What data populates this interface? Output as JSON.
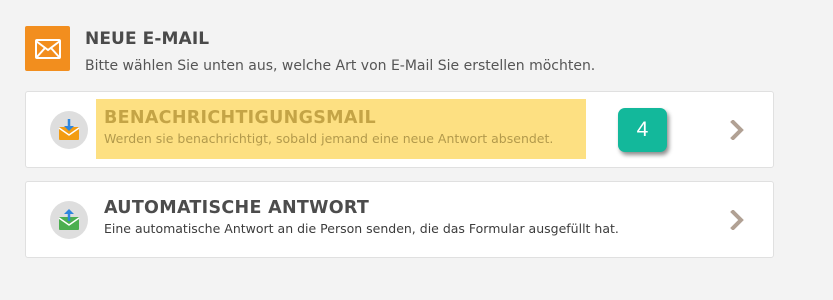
{
  "header": {
    "icon": "envelope-icon",
    "title": "NEUE E-MAIL",
    "subtitle": "Bitte wählen Sie unten aus, welche Art von E-Mail Sie erstellen möchten."
  },
  "options": [
    {
      "icon": "notification-mail-icon",
      "title": "BENACHRICHTIGUNGSMAIL",
      "description": "Werden sie benachrichtigt, sobald jemand eine neue Antwort absendet.",
      "badge": "4",
      "highlighted": true
    },
    {
      "icon": "autoresponder-mail-icon",
      "title": "AUTOMATISCHE ANTWORT",
      "description": "Eine automatische Antwort an die Person senden, die das Formular ausgefüllt hat."
    }
  ],
  "colors": {
    "accent_orange": "#f28e1e",
    "badge_green": "#13b89b",
    "highlight_yellow": "#fde082",
    "chevron": "#b1a194"
  }
}
